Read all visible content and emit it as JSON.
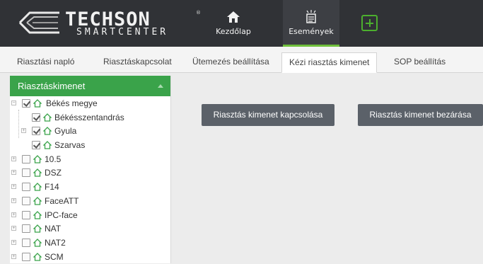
{
  "brand": {
    "name": "TECHSON",
    "sub": "SMARTCENTER",
    "reg": "®"
  },
  "nav": [
    {
      "label": "Kezdőlap",
      "icon": "home-icon"
    },
    {
      "label": "Események",
      "icon": "events-icon"
    }
  ],
  "tabs": [
    "Riasztási napló",
    "Riasztáskapcsolat",
    "Ütemezés beállítása",
    "Kézi riasztás kimenet",
    "SOP beállítás"
  ],
  "active_tab": "Kézi riasztás kimenet",
  "sidebar": {
    "title": "Riasztáskimenet",
    "items": [
      {
        "label": "Békés megye",
        "checked": true,
        "expander": "⊟"
      },
      {
        "label": "Békésszentandrás",
        "checked": true,
        "expander": ""
      },
      {
        "label": "Gyula",
        "checked": true,
        "expander": "⊞"
      },
      {
        "label": "Szarvas",
        "checked": true,
        "expander": ""
      },
      {
        "label": "10.5",
        "checked": false,
        "expander": "⊞"
      },
      {
        "label": "DSZ",
        "checked": false,
        "expander": "⊞"
      },
      {
        "label": "F14",
        "checked": false,
        "expander": "⊞"
      },
      {
        "label": "FaceATT",
        "checked": false,
        "expander": "⊞"
      },
      {
        "label": "IPC-face",
        "checked": false,
        "expander": "⊞"
      },
      {
        "label": "NAT",
        "checked": false,
        "expander": "⊞"
      },
      {
        "label": "NAT2",
        "checked": false,
        "expander": "⊞"
      },
      {
        "label": "SCM",
        "checked": false,
        "expander": "⊞"
      }
    ]
  },
  "actions": {
    "open_label": "Riasztás kimenet kapcsolása",
    "close_label": "Riasztás kimenet bezárása"
  },
  "colors": {
    "topbar": "#303236",
    "accent": "#3aa34a",
    "button": "#5b6169"
  }
}
